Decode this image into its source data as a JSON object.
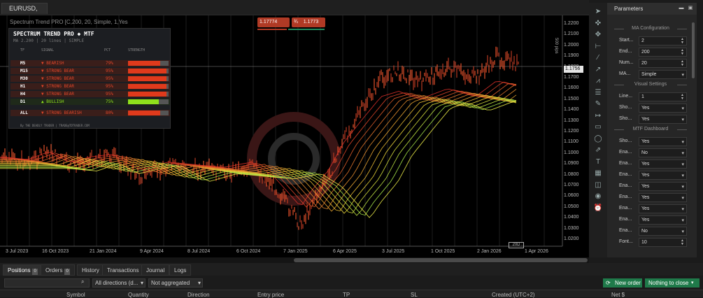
{
  "tab": {
    "symbol": "EURUSD, D1"
  },
  "chart": {
    "title": "Spectrum Trend PRO [C,200, 20, Simple, 1,Yes",
    "price_labels": [
      "1.2200",
      "1.2100",
      "1.2000",
      "1.1900",
      "1.1800",
      "1.1700",
      "1.1600",
      "1.1500",
      "1.1400",
      "1.1300",
      "1.1200",
      "1.1100",
      "1.1000",
      "1.0900",
      "1.0800",
      "1.0700",
      "1.0600",
      "1.0500",
      "1.0400",
      "1.0300",
      "1.0200"
    ],
    "current_price": "1.1756",
    "pips_label": "500 pips",
    "time_labels": [
      "3 Jul 2023",
      "16 Oct 2023",
      "21 Jan 2024",
      "9 Apr 2024",
      "8 Jul 2024",
      "6 Oct 2024",
      "7 Jan 2025",
      "6 Apr 2025",
      "3 Jul 2025",
      "1 Oct 2025",
      "2 Jan 2026",
      "1 Apr 2026"
    ],
    "time_marker": "20D",
    "sell_price": "1.17774",
    "lot_symbol": "¾",
    "buy_price": "1.1773"
  },
  "dashboard": {
    "title": "SPECTRUM TREND PRO  ◆  MTF",
    "subtitle": "MA 2.200  |  20 lines  |  SIMPLE",
    "headers": {
      "tf": "TF",
      "signal": "SIGNAL",
      "pct": "PCT",
      "strength": "STRENGTH"
    },
    "rows": [
      {
        "tf": "M5",
        "signal": "▼ BEARISH",
        "pct": "79%",
        "fill": 79,
        "kind": "bear"
      },
      {
        "tf": "M15",
        "signal": "▼ STRONG BEAR",
        "pct": "95%",
        "fill": 95,
        "kind": "bear"
      },
      {
        "tf": "M30",
        "signal": "▼ STRONG BEAR",
        "pct": "95%",
        "fill": 95,
        "kind": "bear"
      },
      {
        "tf": "H1",
        "signal": "▼ STRONG BEAR",
        "pct": "95%",
        "fill": 95,
        "kind": "bear"
      },
      {
        "tf": "H4",
        "signal": "▼ STRONG BEAR",
        "pct": "95%",
        "fill": 95,
        "kind": "bear"
      },
      {
        "tf": "D1",
        "signal": "▲ BULLISH",
        "pct": "75%",
        "fill": 75,
        "kind": "bull"
      },
      {
        "tf": "ALL",
        "signal": "▼ STRONG BEARISH",
        "pct": "80%",
        "fill": 80,
        "kind": "bear"
      }
    ],
    "footer": "By THE DEADLY TRADER  |  TRADE@TDTRADER.COM",
    "colors": {
      "bear": "#e03a1c",
      "bull": "#8fe01c",
      "bear_text": "#e0462a",
      "bull_text": "#8fe01c"
    }
  },
  "toolbar": {
    "tools": [
      "cursor-icon",
      "crosshair-icon",
      "move-icon",
      "lines-icon",
      "trendline-icon",
      "ray-icon",
      "pitchfork-icon",
      "fibonacci-icon",
      "pen-icon",
      "measure-icon",
      "rectangle-icon",
      "ellipse-icon",
      "arrow-icon",
      "text-icon",
      "template-icon",
      "grid-icon",
      "eye-icon",
      "alarm-icon"
    ],
    "glyphs": [
      "➤",
      "✜",
      "✥",
      "⊢",
      "⁄",
      "↗",
      "⩘",
      "☰",
      "✎",
      "↦",
      "▭",
      "◯",
      "⇗",
      "T",
      "▦",
      "◫",
      "◉",
      "⏰"
    ]
  },
  "parameters": {
    "title": "Parameters",
    "sections": [
      {
        "title": "MA Configuration",
        "rows": [
          {
            "label": "Start...",
            "value": "2",
            "ctl": "stepper"
          },
          {
            "label": "End...",
            "value": "200",
            "ctl": "stepper"
          },
          {
            "label": "Num...",
            "value": "20",
            "ctl": "stepper"
          },
          {
            "label": "MA...",
            "value": "Simple",
            "ctl": "select"
          }
        ]
      },
      {
        "title": "Visual Settings",
        "rows": [
          {
            "label": "Line...",
            "value": "1",
            "ctl": "stepper"
          },
          {
            "label": "Sho...",
            "value": "Yes",
            "ctl": "select"
          },
          {
            "label": "Sho...",
            "value": "Yes",
            "ctl": "select"
          }
        ]
      },
      {
        "title": "MTF Dashboard",
        "rows": [
          {
            "label": "Sho...",
            "value": "Yes",
            "ctl": "select"
          },
          {
            "label": "Ena...",
            "value": "No",
            "ctl": "select"
          },
          {
            "label": "Ena...",
            "value": "Yes",
            "ctl": "select"
          },
          {
            "label": "Ena...",
            "value": "Yes",
            "ctl": "select"
          },
          {
            "label": "Ena...",
            "value": "Yes",
            "ctl": "select"
          },
          {
            "label": "Ena...",
            "value": "Yes",
            "ctl": "select"
          },
          {
            "label": "Ena...",
            "value": "Yes",
            "ctl": "select"
          },
          {
            "label": "Ena...",
            "value": "Yes",
            "ctl": "select"
          },
          {
            "label": "Ena...",
            "value": "No",
            "ctl": "select"
          },
          {
            "label": "Font...",
            "value": "10",
            "ctl": "stepper"
          }
        ]
      }
    ]
  },
  "bottom": {
    "tabs": [
      {
        "label": "Positions",
        "badge": "0",
        "active": true
      },
      {
        "label": "Orders",
        "badge": "0"
      },
      {
        "label": "History"
      },
      {
        "label": "Transactions"
      },
      {
        "label": "Journal"
      },
      {
        "label": "Logs"
      }
    ],
    "direction_filter": "All directions (d...",
    "aggregation": "Not aggregated",
    "new_order": "New order",
    "close_action": "Nothing to close",
    "columns": [
      "Symbol",
      "Quantity",
      "Direction",
      "Entry price",
      "TP",
      "SL",
      "Created (UTC+2)",
      "Net $"
    ]
  }
}
